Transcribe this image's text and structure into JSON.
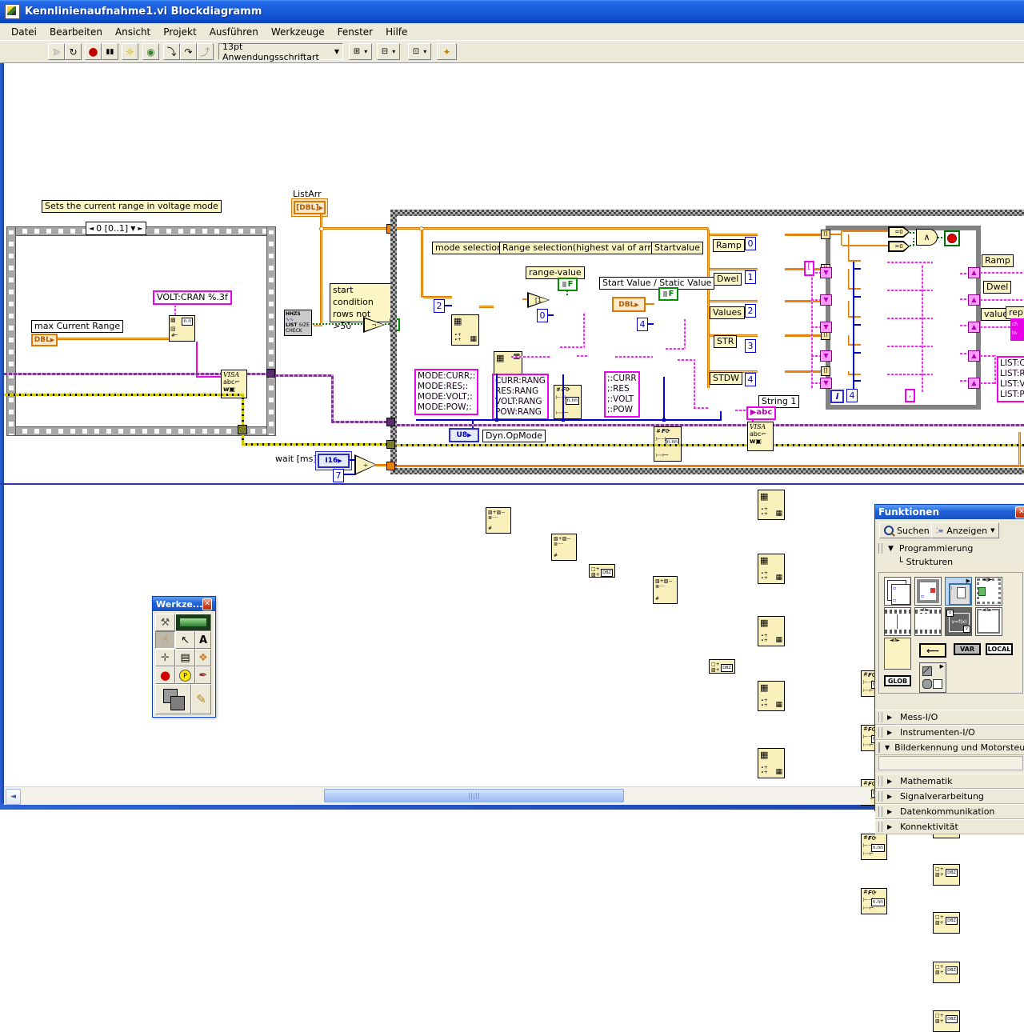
{
  "window": {
    "title": "Kennlinienaufnahme1.vi Blockdiagramm",
    "menu": [
      "Datei",
      "Bearbeiten",
      "Ansicht",
      "Projekt",
      "Ausführen",
      "Werkzeuge",
      "Fenster",
      "Hilfe"
    ]
  },
  "toolbar": {
    "font_selector": "13pt Anwendungsschriftart",
    "run_icon": "➤",
    "run_cont_icon": "↻",
    "abort_icon": "●",
    "pause_icon": "▮▮",
    "highlight_icon": "☼",
    "retain_icon": "◉",
    "step_into_icon": "⤵",
    "step_over_icon": "↷",
    "step_out_icon": "⤴",
    "align_icon": "⊞",
    "distribute_icon": "⊟",
    "resize_icon": "⊡",
    "cleanup_icon": "✦"
  },
  "diagram": {
    "comment_top": "Sets the current range in voltage mode",
    "seq_selector": "0 [0..1]",
    "labels": {
      "volt_cran": "VOLT:CRAN %.3f",
      "max_current_range": "max Current Range",
      "listarr": "ListArr",
      "mode_selection": "mode selection",
      "range_selection": "Range selection(highest val of array)",
      "startvalue": "Startvalue",
      "range_value": "range-value",
      "start_static": "Start Value / Static Value",
      "string1": "String 1",
      "dyn_opmode": "Dyn.OpMode",
      "wait_ms": "wait [ms]",
      "ramp_right": "Ramp",
      "dwel_right": "Dwel",
      "value_right": "value",
      "replace_right": "repla"
    },
    "comment_start_condition": [
      "start",
      "condition",
      "rows not >50"
    ],
    "subvi": {
      "t1": "HHZS",
      "t2": "LIST",
      "t3": "SIZE",
      "t4": "CHECK"
    },
    "terminals": {
      "dbl": "DBL",
      "dbl_array": "[DBL]",
      "dbl_const": "DBL",
      "u8": "U8",
      "i16": "I16",
      "iter": "i",
      "abc": "abc"
    },
    "constants": {
      "two": "2",
      "zero_fmt": "0",
      "four_fmt": "4",
      "seven": "7",
      "comma": ",",
      "four_inner": "4"
    },
    "rows": [
      {
        "label": "Ramp",
        "index": "0"
      },
      {
        "label": "Dwel",
        "index": "1"
      },
      {
        "label": "Values",
        "index": "2"
      },
      {
        "label": "STR",
        "index": "3"
      },
      {
        "label": "STDW",
        "index": "4"
      }
    ],
    "strings": {
      "mode": [
        "MODE:CURR;:",
        "MODE:RES;:",
        "MODE:VOLT;:",
        "MODE:POW;:"
      ],
      "rang": [
        "CURR:RANG",
        "RES:RANG",
        "VOLT:RANG",
        "POW:RANG"
      ],
      "ops": [
        ";:CURR",
        ";:RES",
        ";:VOLT",
        ";:POW"
      ],
      "list": [
        "LIST:C",
        "LIST:R",
        "LIST:V",
        "LIST:P"
      ],
      "replace_box": [
        "ch",
        "to"
      ]
    },
    "glyphs": {
      "eq0": "=0",
      "and": "∧",
      "not": "¬",
      "div": "÷",
      "f_const": "F",
      "question": "?",
      "bracket": "["
    },
    "visa": {
      "t1": "VISA",
      "t2": "abc⌐",
      "t3": "w▣"
    }
  },
  "tools_palette": {
    "title": "Werkze...",
    "close": "✕",
    "icons": {
      "auto": "⚒",
      "operate": "☝",
      "position": "↖",
      "text": "A",
      "wire": "✛",
      "menu": "▤",
      "scroll": "❖",
      "breakpoint": "●",
      "probe": "P",
      "color_copy": "✒",
      "brush": "✎"
    }
  },
  "functions_palette": {
    "title": "Funktionen",
    "search_label": "Suchen",
    "view_label": "Anzeigen",
    "view_arrow": "▼",
    "tree": {
      "root_arrow": "▼",
      "root": "Programmierung",
      "child_prefix": "└",
      "child": "Strukturen"
    },
    "icons": {
      "var": "VAR",
      "local": "LOCAL",
      "glob": "GLOB",
      "formula": "v=f(x)",
      "sel0": "◄0►"
    },
    "categories": [
      {
        "arrow": "▶",
        "label": "Mess-I/O"
      },
      {
        "arrow": "▶",
        "label": "Instrumenten-I/O"
      },
      {
        "arrow": "▼",
        "label": "Bilderkennung und Motorsteuerung"
      },
      {
        "arrow": "▶",
        "label": "Mathematik"
      },
      {
        "arrow": "▶",
        "label": "Signalverarbeitung"
      },
      {
        "arrow": "▶",
        "label": "Datenkommunikation"
      },
      {
        "arrow": "▶",
        "label": "Konnektivität"
      }
    ]
  },
  "scrollbar": {
    "left_arrow": "◄"
  },
  "colors": {
    "accent_orange": "#E8820C",
    "accent_pink": "#F000F0",
    "accent_blue": "#0000C8",
    "accent_purple": "#7B3A8D",
    "xp_blue": "#1C5FDE",
    "node_yellow": "#F9F0BC"
  }
}
